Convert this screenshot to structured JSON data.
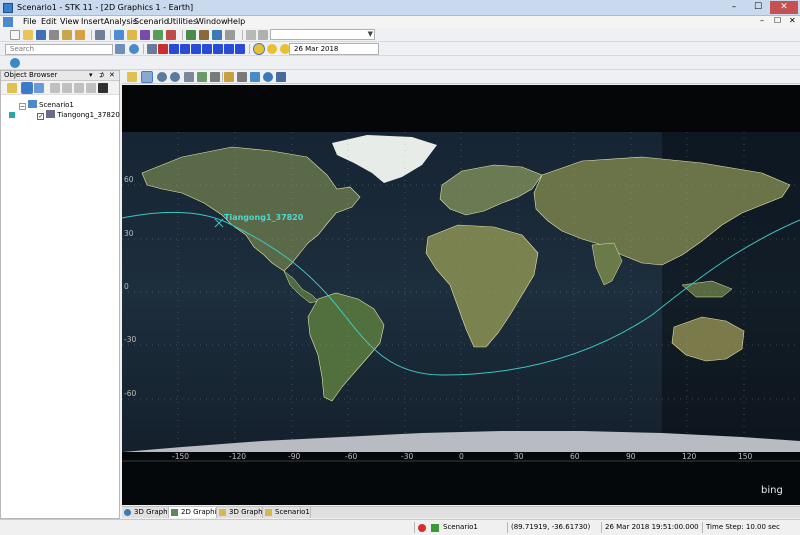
{
  "window": {
    "title": "Scenario1 - STK 11 - [2D Graphics 1 - Earth]",
    "min_glyph": "–",
    "max_glyph": "☐",
    "close_glyph": "✕"
  },
  "menu": {
    "items": [
      "File",
      "Edit",
      "View",
      "Insert",
      "Analysis",
      "Scenario",
      "Utilities",
      "Window",
      "Help"
    ],
    "mdi_controls": [
      "–",
      "☐",
      "✕"
    ]
  },
  "search": {
    "placeholder": "Search"
  },
  "animation": {
    "current_time": "26 Mar 2018 19:51:00.000"
  },
  "object_browser": {
    "title": "Object Browser",
    "controls": [
      "▾",
      "⊅",
      "✕"
    ],
    "scenario_name": "Scenario1",
    "satellite_name": "Tiangong1_37820",
    "expander_glyph": "−",
    "check_glyph": "✓"
  },
  "map": {
    "satellite_label": "Tiangong1_37820",
    "lat_labels": [
      "60",
      "30",
      "0",
      "-30",
      "-60"
    ],
    "lon_labels": [
      "-150",
      "-120",
      "-90",
      "-60",
      "-30",
      "0",
      "30",
      "60",
      "90",
      "120",
      "150"
    ],
    "attribution": "bing",
    "colors": {
      "ground_track": "#3fc7c4",
      "land_outline": "#e8e6a8",
      "grid": "#9aa0a6"
    }
  },
  "tabs": [
    {
      "label": "3D Graphic..."
    },
    {
      "label": "2D Graphic..."
    },
    {
      "label": "3D Graphic..."
    },
    {
      "label": "Scenario1 : ..."
    }
  ],
  "status": {
    "scenario": "Scenario1",
    "coordinates": "(89.71919, -36.61730)",
    "time": "26 Mar 2018 19:51:00.000",
    "time_step": "Time Step: 10.00 sec"
  },
  "icons": [
    "app-icon",
    "folder-open-icon",
    "save-icon",
    "print-icon",
    "search-icon",
    "globe-icon",
    "play-icon",
    "pause-icon",
    "rewind-icon",
    "step-forward-icon",
    "zoom-in-icon",
    "zoom-out-icon",
    "pan-hand-icon",
    "scenario-icon",
    "satellite-icon",
    "binoculars-icon",
    "bing-logo-icon"
  ]
}
